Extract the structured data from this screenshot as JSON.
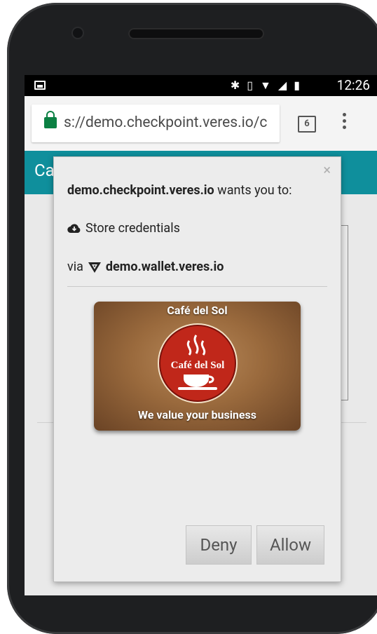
{
  "statusbar": {
    "time": "12:26",
    "icons": [
      "image-icon",
      "bluetooth-icon",
      "vibrate-icon",
      "wifi-icon",
      "signal-icon",
      "battery-icon"
    ]
  },
  "browser": {
    "url": "s://demo.checkpoint.veres.io/c",
    "tab_count": "6"
  },
  "page": {
    "header_text": "Ca"
  },
  "dialog": {
    "close_label": "×",
    "origin": "demo.checkpoint.veres.io",
    "wants_text": " wants you to:",
    "permission": "Store credentials",
    "via_label": "via",
    "wallet": "demo.wallet.veres.io",
    "card": {
      "title": "Café del Sol",
      "logo_text": "Café del Sol",
      "footer": "We value your business"
    },
    "deny_label": "Deny",
    "allow_label": "Allow"
  },
  "colors": {
    "header_teal": "#0f8f9c",
    "lock_green": "#0b8043",
    "logo_red": "#c0271a"
  }
}
